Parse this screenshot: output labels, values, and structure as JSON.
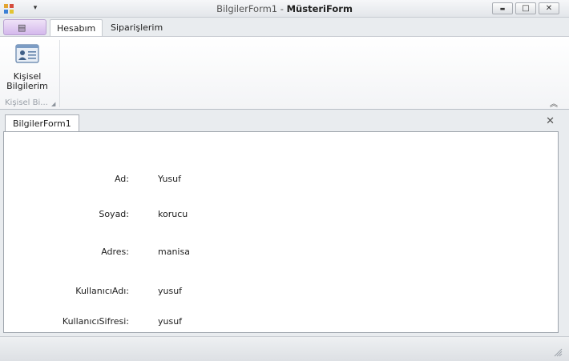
{
  "window": {
    "title_prefix": "BilgilerForm1 - ",
    "title_main": "MüsteriForm",
    "minimize_glyph": "▬",
    "maximize_glyph": "□",
    "close_glyph": "✕",
    "qat_glyph": "▾"
  },
  "ribbon": {
    "app_button_glyph": "▤",
    "tabs": [
      "Hesabım",
      "Siparişlerim"
    ],
    "active_tab": "Hesabım",
    "button": {
      "label_line1": "Kişisel",
      "label_line2": "Bilgilerim",
      "icon": "contact-card-icon"
    },
    "group_label": "Kişisel Bi...",
    "group_launcher_glyph": "◢",
    "collapse_glyph": "︽"
  },
  "document": {
    "tab_label": "BilgilerForm1",
    "close_glyph": "✕",
    "fields": [
      {
        "label": "Ad:",
        "value": "Yusuf"
      },
      {
        "label": "Soyad:",
        "value": "korucu"
      },
      {
        "label": "Adres:",
        "value": "manisa"
      },
      {
        "label": "KullanıcıAdı:",
        "value": "yusuf"
      },
      {
        "label": "KullanıcıSifresi:",
        "value": "yusuf"
      }
    ]
  },
  "colors": {
    "accent_app_button": "#d4b8ec",
    "window_bg": "#e9ecef"
  }
}
